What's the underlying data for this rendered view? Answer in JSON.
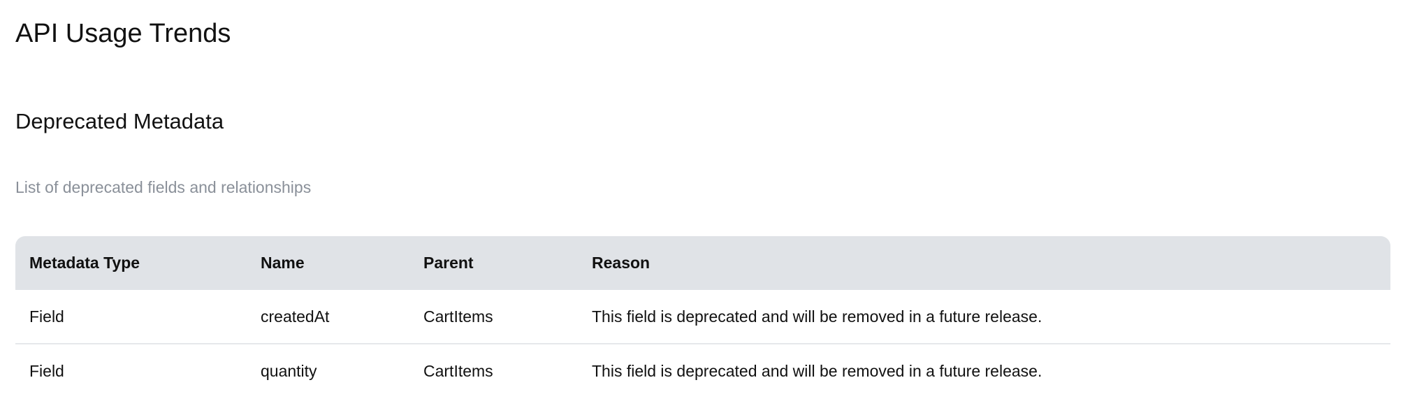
{
  "page": {
    "title": "API Usage Trends"
  },
  "section": {
    "title": "Deprecated Metadata",
    "description": "List of deprecated fields and relationships"
  },
  "table": {
    "headers": [
      "Metadata Type",
      "Name",
      "Parent",
      "Reason"
    ],
    "rows": [
      [
        "Field",
        "createdAt",
        "CartItems",
        "This field is deprecated and will be removed in a future release."
      ],
      [
        "Field",
        "quantity",
        "CartItems",
        "This field is deprecated and will be removed in a future release."
      ]
    ]
  },
  "colors": {
    "header_background": "#e0e3e7",
    "muted_text": "#8a9099",
    "row_divider": "#e6e8eb"
  }
}
